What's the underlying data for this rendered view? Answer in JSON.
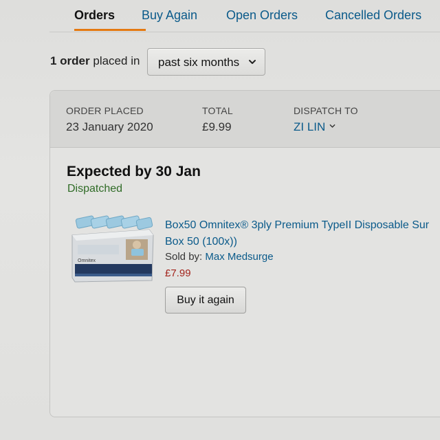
{
  "tabs": [
    {
      "label": "Orders",
      "active": true
    },
    {
      "label": "Buy Again",
      "active": false
    },
    {
      "label": "Open Orders",
      "active": false
    },
    {
      "label": "Cancelled Orders",
      "active": false
    }
  ],
  "summary": {
    "count": "1 order",
    "text": "placed in"
  },
  "filter": {
    "selected": "past six months",
    "icon": "chevron-down-icon"
  },
  "order": {
    "order_placed_label": "ORDER PLACED",
    "order_placed_value": "23 January 2020",
    "total_label": "TOTAL",
    "total_value": "£9.99",
    "dispatch_label": "DISPATCH TO",
    "dispatch_value": "ZI LIN",
    "expected": "Expected by 30 Jan",
    "status": "Dispatched",
    "item": {
      "title_line1": "Box50 Omnitex® 3ply Premium TypeII Disposable Sur",
      "title_line2": "Box 50 (100x))",
      "sold_by_label": "Sold by:",
      "seller": "Max Medsurge",
      "price": "£7.99",
      "image_text": "Omnitex",
      "buy_again_label": "Buy it again"
    }
  },
  "colors": {
    "link": "#0a5a8a",
    "accent_underline": "#e47911",
    "status_green": "#2f6b26",
    "price_red": "#a3241c"
  }
}
